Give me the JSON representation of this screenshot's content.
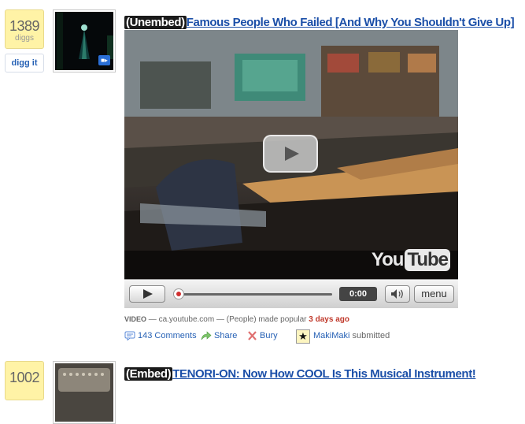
{
  "story1": {
    "diggs": "1389",
    "diggs_label": "diggs",
    "digg_button": "digg it",
    "tag": "(Unembed)",
    "title": "Famous People Who Failed [And Why You Shouldn't Give Up]",
    "player": {
      "logo_you": "You",
      "logo_tube": "Tube",
      "time": "0:00",
      "menu_label": "menu",
      "progress": 0
    },
    "meta": {
      "type": "VIDEO",
      "sep1": " — ",
      "source": "ca.youtube.com",
      "sep2": " — ",
      "category": "(People)",
      "made_popular": " made popular ",
      "ago": "3 days ago"
    },
    "actions": {
      "comments": "143 Comments",
      "share": "Share",
      "bury": "Bury",
      "username": "MakiMaki",
      "submitted": " submitted"
    }
  },
  "story2": {
    "diggs": "1002",
    "tag": "(Embed)",
    "title": "TENORI-ON: Now How COOL Is This Musical Instrument!"
  },
  "colors": {
    "digg_box": "#fff3a6",
    "link": "#1b4fa8",
    "ago": "#c0392b"
  }
}
